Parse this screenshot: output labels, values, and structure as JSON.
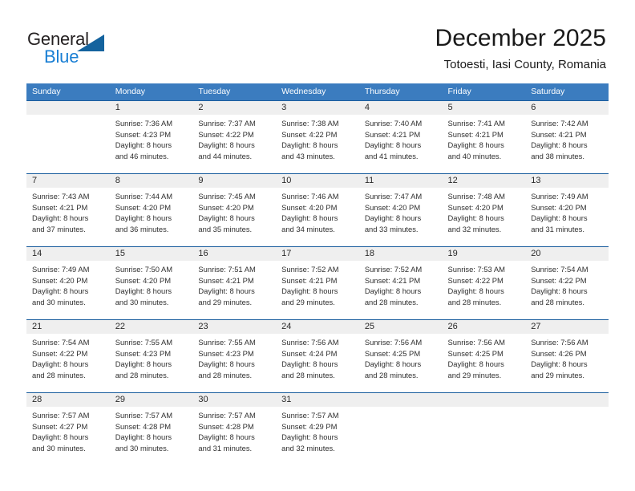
{
  "logo": {
    "word_general": "General",
    "word_blue": "Blue",
    "accent_color": "#14639e",
    "blue_text_color": "#1a7fd4"
  },
  "header": {
    "title": "December 2025",
    "subtitle": "Totoesti, Iasi County, Romania"
  },
  "theme": {
    "header_row_bg": "#3b7cbf",
    "daynum_band_bg": "#efefef",
    "week_divider": "#1a5d9e"
  },
  "weekday_headers": [
    "Sunday",
    "Monday",
    "Tuesday",
    "Wednesday",
    "Thursday",
    "Friday",
    "Saturday"
  ],
  "weeks": [
    [
      {
        "day": "",
        "sunrise": "",
        "sunset": "",
        "daylight_line1": "",
        "daylight_line2": "",
        "empty": true
      },
      {
        "day": "1",
        "sunrise": "Sunrise: 7:36 AM",
        "sunset": "Sunset: 4:23 PM",
        "daylight_line1": "Daylight: 8 hours",
        "daylight_line2": "and 46 minutes.",
        "empty": false
      },
      {
        "day": "2",
        "sunrise": "Sunrise: 7:37 AM",
        "sunset": "Sunset: 4:22 PM",
        "daylight_line1": "Daylight: 8 hours",
        "daylight_line2": "and 44 minutes.",
        "empty": false
      },
      {
        "day": "3",
        "sunrise": "Sunrise: 7:38 AM",
        "sunset": "Sunset: 4:22 PM",
        "daylight_line1": "Daylight: 8 hours",
        "daylight_line2": "and 43 minutes.",
        "empty": false
      },
      {
        "day": "4",
        "sunrise": "Sunrise: 7:40 AM",
        "sunset": "Sunset: 4:21 PM",
        "daylight_line1": "Daylight: 8 hours",
        "daylight_line2": "and 41 minutes.",
        "empty": false
      },
      {
        "day": "5",
        "sunrise": "Sunrise: 7:41 AM",
        "sunset": "Sunset: 4:21 PM",
        "daylight_line1": "Daylight: 8 hours",
        "daylight_line2": "and 40 minutes.",
        "empty": false
      },
      {
        "day": "6",
        "sunrise": "Sunrise: 7:42 AM",
        "sunset": "Sunset: 4:21 PM",
        "daylight_line1": "Daylight: 8 hours",
        "daylight_line2": "and 38 minutes.",
        "empty": false
      }
    ],
    [
      {
        "day": "7",
        "sunrise": "Sunrise: 7:43 AM",
        "sunset": "Sunset: 4:21 PM",
        "daylight_line1": "Daylight: 8 hours",
        "daylight_line2": "and 37 minutes.",
        "empty": false
      },
      {
        "day": "8",
        "sunrise": "Sunrise: 7:44 AM",
        "sunset": "Sunset: 4:20 PM",
        "daylight_line1": "Daylight: 8 hours",
        "daylight_line2": "and 36 minutes.",
        "empty": false
      },
      {
        "day": "9",
        "sunrise": "Sunrise: 7:45 AM",
        "sunset": "Sunset: 4:20 PM",
        "daylight_line1": "Daylight: 8 hours",
        "daylight_line2": "and 35 minutes.",
        "empty": false
      },
      {
        "day": "10",
        "sunrise": "Sunrise: 7:46 AM",
        "sunset": "Sunset: 4:20 PM",
        "daylight_line1": "Daylight: 8 hours",
        "daylight_line2": "and 34 minutes.",
        "empty": false
      },
      {
        "day": "11",
        "sunrise": "Sunrise: 7:47 AM",
        "sunset": "Sunset: 4:20 PM",
        "daylight_line1": "Daylight: 8 hours",
        "daylight_line2": "and 33 minutes.",
        "empty": false
      },
      {
        "day": "12",
        "sunrise": "Sunrise: 7:48 AM",
        "sunset": "Sunset: 4:20 PM",
        "daylight_line1": "Daylight: 8 hours",
        "daylight_line2": "and 32 minutes.",
        "empty": false
      },
      {
        "day": "13",
        "sunrise": "Sunrise: 7:49 AM",
        "sunset": "Sunset: 4:20 PM",
        "daylight_line1": "Daylight: 8 hours",
        "daylight_line2": "and 31 minutes.",
        "empty": false
      }
    ],
    [
      {
        "day": "14",
        "sunrise": "Sunrise: 7:49 AM",
        "sunset": "Sunset: 4:20 PM",
        "daylight_line1": "Daylight: 8 hours",
        "daylight_line2": "and 30 minutes.",
        "empty": false
      },
      {
        "day": "15",
        "sunrise": "Sunrise: 7:50 AM",
        "sunset": "Sunset: 4:20 PM",
        "daylight_line1": "Daylight: 8 hours",
        "daylight_line2": "and 30 minutes.",
        "empty": false
      },
      {
        "day": "16",
        "sunrise": "Sunrise: 7:51 AM",
        "sunset": "Sunset: 4:21 PM",
        "daylight_line1": "Daylight: 8 hours",
        "daylight_line2": "and 29 minutes.",
        "empty": false
      },
      {
        "day": "17",
        "sunrise": "Sunrise: 7:52 AM",
        "sunset": "Sunset: 4:21 PM",
        "daylight_line1": "Daylight: 8 hours",
        "daylight_line2": "and 29 minutes.",
        "empty": false
      },
      {
        "day": "18",
        "sunrise": "Sunrise: 7:52 AM",
        "sunset": "Sunset: 4:21 PM",
        "daylight_line1": "Daylight: 8 hours",
        "daylight_line2": "and 28 minutes.",
        "empty": false
      },
      {
        "day": "19",
        "sunrise": "Sunrise: 7:53 AM",
        "sunset": "Sunset: 4:22 PM",
        "daylight_line1": "Daylight: 8 hours",
        "daylight_line2": "and 28 minutes.",
        "empty": false
      },
      {
        "day": "20",
        "sunrise": "Sunrise: 7:54 AM",
        "sunset": "Sunset: 4:22 PM",
        "daylight_line1": "Daylight: 8 hours",
        "daylight_line2": "and 28 minutes.",
        "empty": false
      }
    ],
    [
      {
        "day": "21",
        "sunrise": "Sunrise: 7:54 AM",
        "sunset": "Sunset: 4:22 PM",
        "daylight_line1": "Daylight: 8 hours",
        "daylight_line2": "and 28 minutes.",
        "empty": false
      },
      {
        "day": "22",
        "sunrise": "Sunrise: 7:55 AM",
        "sunset": "Sunset: 4:23 PM",
        "daylight_line1": "Daylight: 8 hours",
        "daylight_line2": "and 28 minutes.",
        "empty": false
      },
      {
        "day": "23",
        "sunrise": "Sunrise: 7:55 AM",
        "sunset": "Sunset: 4:23 PM",
        "daylight_line1": "Daylight: 8 hours",
        "daylight_line2": "and 28 minutes.",
        "empty": false
      },
      {
        "day": "24",
        "sunrise": "Sunrise: 7:56 AM",
        "sunset": "Sunset: 4:24 PM",
        "daylight_line1": "Daylight: 8 hours",
        "daylight_line2": "and 28 minutes.",
        "empty": false
      },
      {
        "day": "25",
        "sunrise": "Sunrise: 7:56 AM",
        "sunset": "Sunset: 4:25 PM",
        "daylight_line1": "Daylight: 8 hours",
        "daylight_line2": "and 28 minutes.",
        "empty": false
      },
      {
        "day": "26",
        "sunrise": "Sunrise: 7:56 AM",
        "sunset": "Sunset: 4:25 PM",
        "daylight_line1": "Daylight: 8 hours",
        "daylight_line2": "and 29 minutes.",
        "empty": false
      },
      {
        "day": "27",
        "sunrise": "Sunrise: 7:56 AM",
        "sunset": "Sunset: 4:26 PM",
        "daylight_line1": "Daylight: 8 hours",
        "daylight_line2": "and 29 minutes.",
        "empty": false
      }
    ],
    [
      {
        "day": "28",
        "sunrise": "Sunrise: 7:57 AM",
        "sunset": "Sunset: 4:27 PM",
        "daylight_line1": "Daylight: 8 hours",
        "daylight_line2": "and 30 minutes.",
        "empty": false
      },
      {
        "day": "29",
        "sunrise": "Sunrise: 7:57 AM",
        "sunset": "Sunset: 4:28 PM",
        "daylight_line1": "Daylight: 8 hours",
        "daylight_line2": "and 30 minutes.",
        "empty": false
      },
      {
        "day": "30",
        "sunrise": "Sunrise: 7:57 AM",
        "sunset": "Sunset: 4:28 PM",
        "daylight_line1": "Daylight: 8 hours",
        "daylight_line2": "and 31 minutes.",
        "empty": false
      },
      {
        "day": "31",
        "sunrise": "Sunrise: 7:57 AM",
        "sunset": "Sunset: 4:29 PM",
        "daylight_line1": "Daylight: 8 hours",
        "daylight_line2": "and 32 minutes.",
        "empty": false
      },
      {
        "day": "",
        "sunrise": "",
        "sunset": "",
        "daylight_line1": "",
        "daylight_line2": "",
        "empty": true
      },
      {
        "day": "",
        "sunrise": "",
        "sunset": "",
        "daylight_line1": "",
        "daylight_line2": "",
        "empty": true
      },
      {
        "day": "",
        "sunrise": "",
        "sunset": "",
        "daylight_line1": "",
        "daylight_line2": "",
        "empty": true
      }
    ]
  ]
}
